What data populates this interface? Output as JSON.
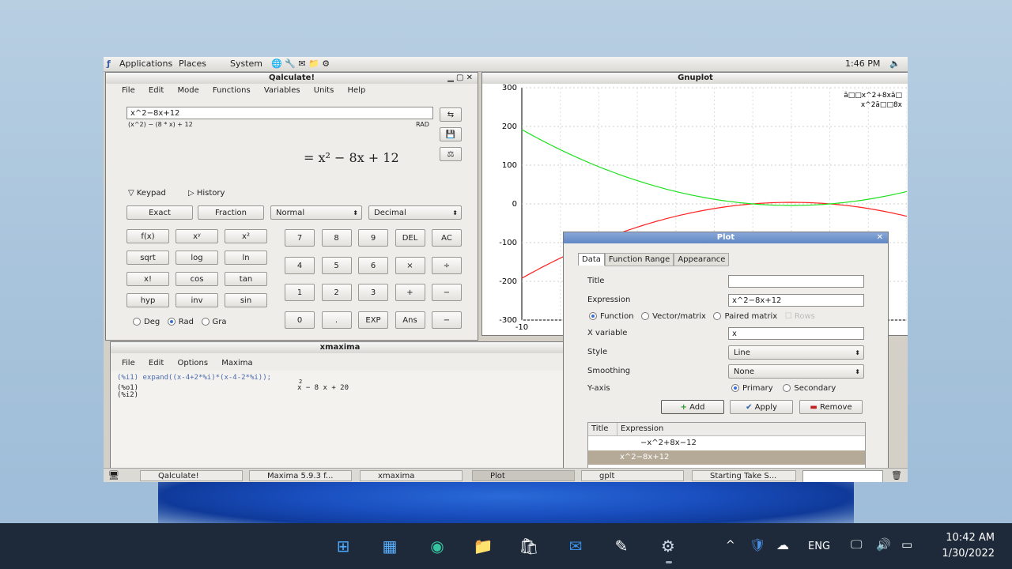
{
  "gnome_panel": {
    "menus": [
      "Applications",
      "Places",
      "System"
    ],
    "clock": "1:46 PM"
  },
  "qalculate": {
    "title": "Qalculate!",
    "menus": [
      "File",
      "Edit",
      "Mode",
      "Functions",
      "Variables",
      "Units",
      "Help"
    ],
    "input": "x^2−8x+12",
    "parsed": "(x^2) − (8 * x) + 12",
    "angle_mode": "RAD",
    "result": "= x² − 8x + 12",
    "keypad_label": "Keypad",
    "history_label": "History",
    "exact_label": "Exact",
    "fraction_label": "Fraction",
    "format_select": "Normal",
    "base_select": "Decimal",
    "fn_keys": [
      "f(x)",
      "xʸ",
      "x²",
      "sqrt",
      "log",
      "ln",
      "x!",
      "cos",
      "tan",
      "hyp",
      "inv",
      "sin"
    ],
    "num_keys": [
      "7",
      "8",
      "9",
      "DEL",
      "AC",
      "4",
      "5",
      "6",
      "×",
      "÷",
      "1",
      "2",
      "3",
      "+",
      "−",
      "0",
      ".",
      "EXP",
      "Ans",
      "−"
    ],
    "angle_options": [
      "Deg",
      "Rad",
      "Gra"
    ]
  },
  "gnuplot": {
    "title": "Gnuplot",
    "legend": [
      "ā□□x^2+8xā□",
      "x^2ā□□8x"
    ],
    "chart_data": {
      "type": "line",
      "xlim": [
        -10,
        10
      ],
      "ylim": [
        -300,
        300
      ],
      "yticks": [
        "300",
        "200",
        "100",
        "0",
        "-100",
        "-200",
        "-300"
      ],
      "xticks": [
        "-10"
      ],
      "series": [
        {
          "expression": "-x^2+8x-12",
          "color": "#ff2020"
        },
        {
          "expression": "x^2-8x+12",
          "color": "#20e020"
        }
      ]
    }
  },
  "xmaxima": {
    "title": "xmaxima",
    "menus": [
      "File",
      "Edit",
      "Options",
      "Maxima"
    ],
    "line1": "(%i1) expand((x-4+2*%i)*(x-4-2*%i));",
    "out_exp": "2",
    "line2_label": "(%o1)",
    "line2_value": "x  − 8 x + 20",
    "line3": "(%i2)"
  },
  "plot_dialog": {
    "title": "Plot",
    "tabs": [
      "Data",
      "Function Range",
      "Appearance"
    ],
    "title_label": "Title",
    "title_value": "",
    "expression_label": "Expression",
    "expression_value": "x^2−8x+12",
    "type_options": [
      "Function",
      "Vector/matrix",
      "Paired matrix",
      "Rows"
    ],
    "xvar_label": "X variable",
    "xvar_value": "x",
    "style_label": "Style",
    "style_value": "Line",
    "smoothing_label": "Smoothing",
    "smoothing_value": "None",
    "yaxis_label": "Y-axis",
    "yaxis_options": [
      "Primary",
      "Secondary"
    ],
    "add_label": "Add",
    "apply_label": "Apply",
    "remove_label": "Remove",
    "table_headers": [
      "Title",
      "Expression"
    ],
    "table_rows": [
      "−x^2+8x−12",
      "x^2−8x+12"
    ]
  },
  "vm_taskbar": [
    "Qalculate!",
    "Maxima 5.9.3 f...",
    "xmaxima",
    "Plot",
    "gplt",
    "Starting Take S..."
  ],
  "win_taskbar": {
    "lang": "ENG",
    "time": "10:42 AM",
    "date": "1/30/2022"
  },
  "colors": {
    "gnome_panel": "#dcdad5",
    "selected_row": "#b5aa98",
    "windows_taskbar": "#1e2a3a"
  }
}
